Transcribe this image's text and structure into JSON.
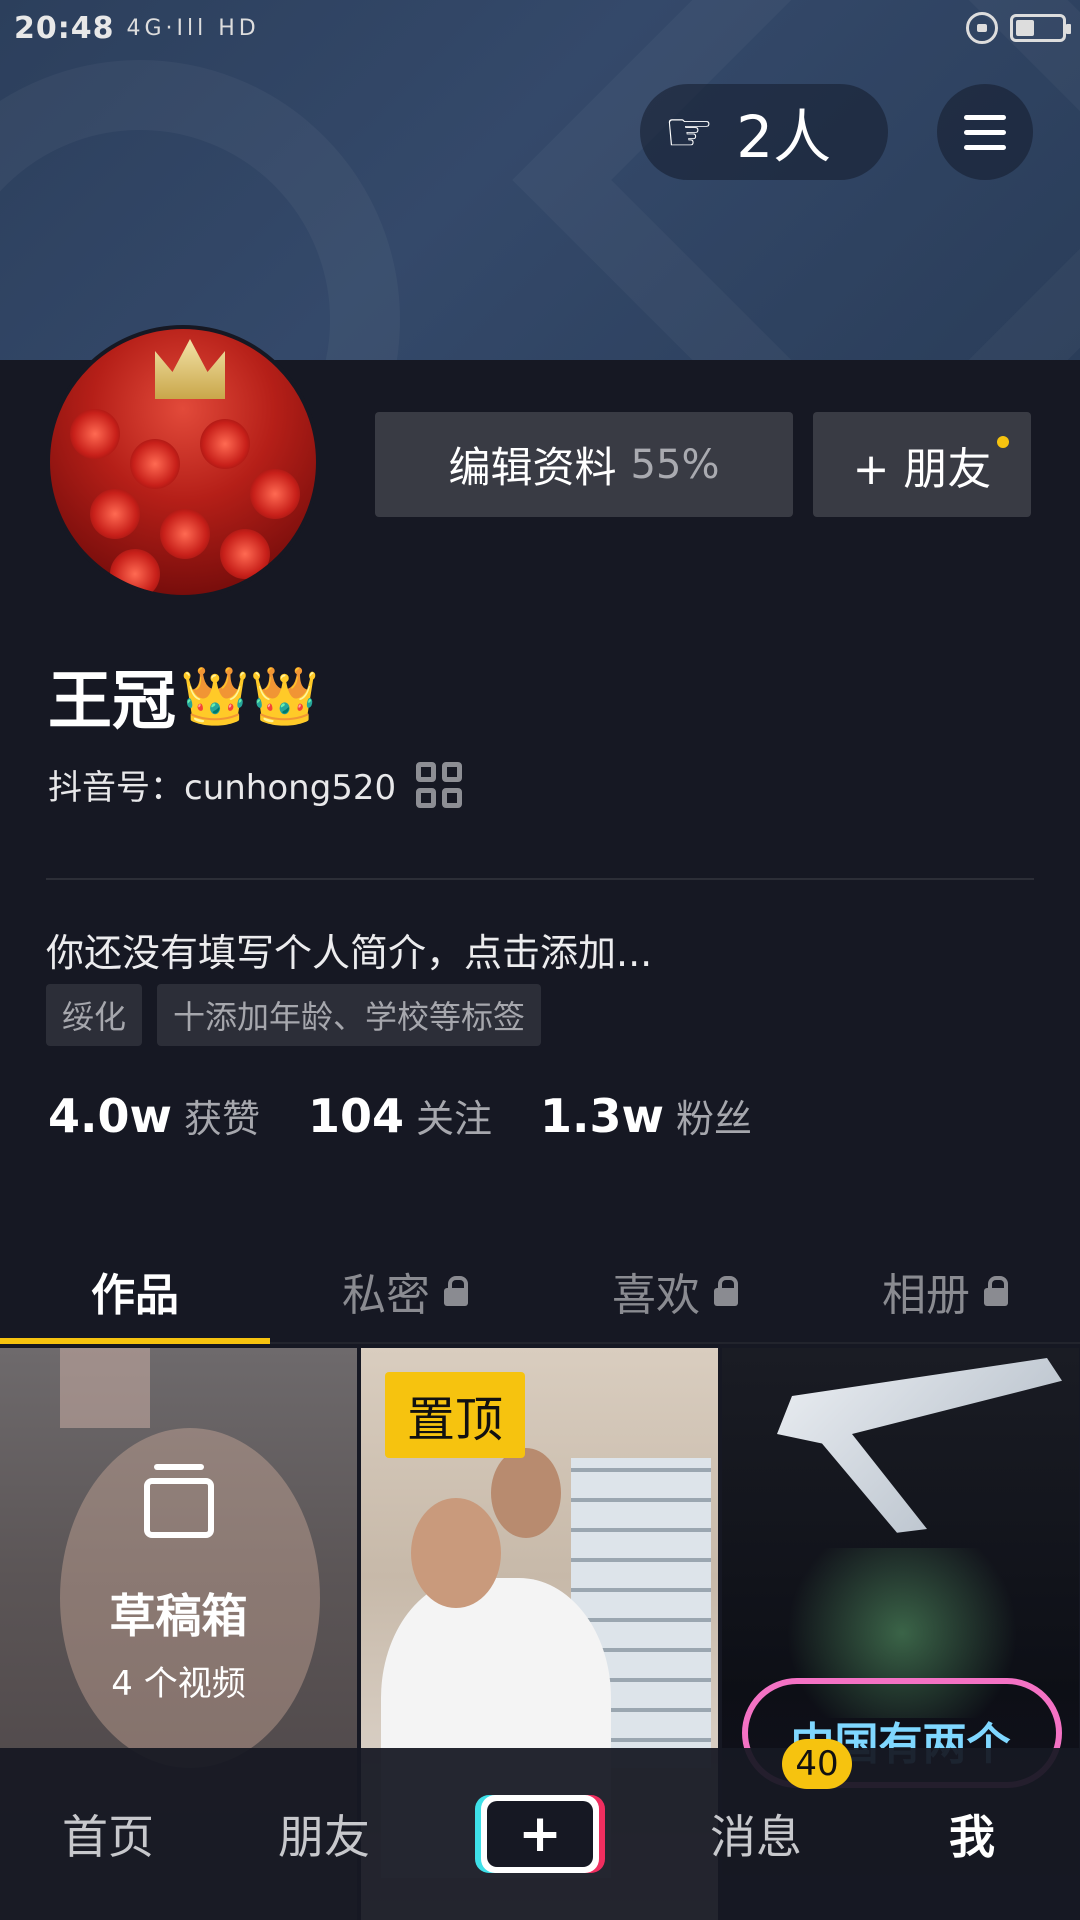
{
  "status_bar": {
    "time": "20:48",
    "signal_text": "4G·Ill HD"
  },
  "header": {
    "visitor_count": "2人"
  },
  "profile": {
    "edit_label": "编辑资料",
    "edit_progress": "55%",
    "add_friend_label": "+ 朋友",
    "name": "王冠",
    "name_emoji": "👑👑",
    "douyin_id": "抖音号：cunhong520",
    "bio": "你还没有填写个人简介，点击添加...",
    "tags": [
      "绥化",
      "十添加年龄、学校等标签"
    ]
  },
  "stats": [
    {
      "value": "4.0w",
      "label": "获赞"
    },
    {
      "value": "104",
      "label": "关注"
    },
    {
      "value": "1.3w",
      "label": "粉丝"
    }
  ],
  "tabs": [
    {
      "label": "作品"
    },
    {
      "label": "私密"
    },
    {
      "label": "喜欢"
    },
    {
      "label": "相册"
    }
  ],
  "grid": {
    "draft_title": "草稿箱",
    "draft_count": "4 个视频",
    "pinned_label": "置顶",
    "video3_caption": "中国有两个"
  },
  "bottom_nav": {
    "home": "首页",
    "friends": "朋友",
    "plus": "+",
    "messages": "消息",
    "messages_badge": "40",
    "me": "我"
  },
  "colors": {
    "accent": "#f6c30f",
    "background": "#161823",
    "button": "#393b44"
  }
}
